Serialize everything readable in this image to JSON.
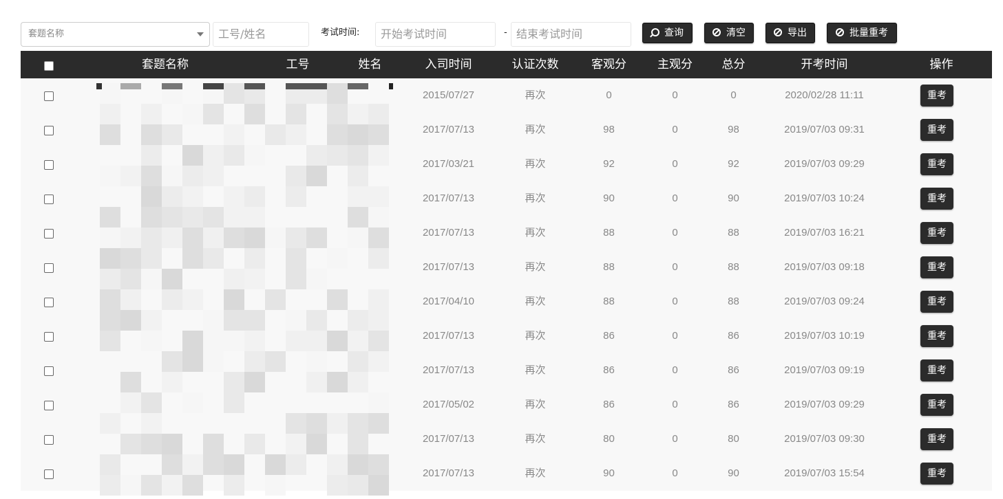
{
  "filters": {
    "paper_select_placeholder": "套题名称",
    "emp_placeholder": "工号/姓名",
    "exam_time_label": "考试时间:",
    "start_placeholder": "开始考试时间",
    "dash": "-",
    "end_placeholder": "结束考试时间"
  },
  "buttons": {
    "search": "查询",
    "clear": "清空",
    "export": "导出",
    "batch_retest": "批量重考"
  },
  "table": {
    "columns": [
      "套题名称",
      "工号",
      "姓名",
      "入司时间",
      "认证次数",
      "客观分",
      "主观分",
      "总分",
      "开考时间",
      "操作"
    ],
    "action_label": "重考",
    "rows": [
      {
        "join": "2015/07/27",
        "times": "再次",
        "obj": "0",
        "subj": "0",
        "total": "0",
        "start": "2020/02/28 11:11"
      },
      {
        "join": "2017/07/13",
        "times": "再次",
        "obj": "98",
        "subj": "0",
        "total": "98",
        "start": "2019/07/03 09:31"
      },
      {
        "join": "2017/03/21",
        "times": "再次",
        "obj": "92",
        "subj": "0",
        "total": "92",
        "start": "2019/07/03 09:29"
      },
      {
        "join": "2017/07/13",
        "times": "再次",
        "obj": "90",
        "subj": "0",
        "total": "90",
        "start": "2019/07/03 10:24"
      },
      {
        "join": "2017/07/13",
        "times": "再次",
        "obj": "88",
        "subj": "0",
        "total": "88",
        "start": "2019/07/03 16:21"
      },
      {
        "join": "2017/07/13",
        "times": "再次",
        "obj": "88",
        "subj": "0",
        "total": "88",
        "start": "2019/07/03 09:18"
      },
      {
        "join": "2017/04/10",
        "times": "再次",
        "obj": "88",
        "subj": "0",
        "total": "88",
        "start": "2019/07/03 09:24"
      },
      {
        "join": "2017/07/13",
        "times": "再次",
        "obj": "86",
        "subj": "0",
        "total": "86",
        "start": "2019/07/03 10:19"
      },
      {
        "join": "2017/07/13",
        "times": "再次",
        "obj": "86",
        "subj": "0",
        "total": "86",
        "start": "2019/07/03 09:19"
      },
      {
        "join": "2017/05/02",
        "times": "再次",
        "obj": "86",
        "subj": "0",
        "total": "86",
        "start": "2019/07/03 09:29"
      },
      {
        "join": "2017/07/13",
        "times": "再次",
        "obj": "80",
        "subj": "0",
        "total": "80",
        "start": "2019/07/03 09:30"
      },
      {
        "join": "2017/07/13",
        "times": "再次",
        "obj": "90",
        "subj": "0",
        "total": "90",
        "start": "2019/07/03 15:54"
      }
    ]
  },
  "colors": {
    "header_bg": "#2b2b2b",
    "row_bg": "#f8f8f8",
    "cell_text": "#888888"
  }
}
